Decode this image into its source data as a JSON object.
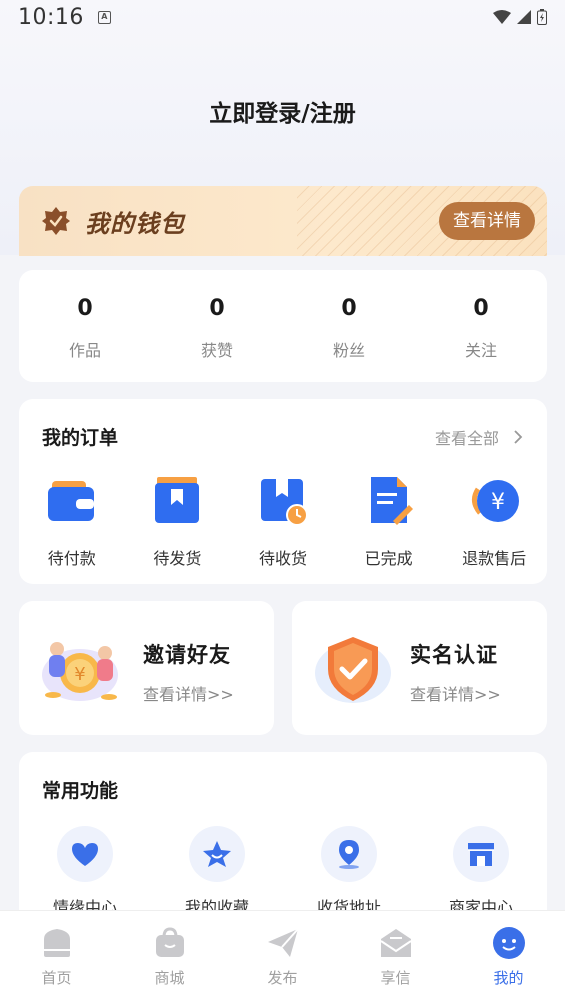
{
  "status_bar": {
    "time": "10:16",
    "notification_icon": "a-icon"
  },
  "header": {
    "login_text": "立即登录/注册"
  },
  "wallet": {
    "title": "我的钱包",
    "detail_button": "查看详情",
    "icon": "badge-icon"
  },
  "stats": [
    {
      "value": "0",
      "label": "作品"
    },
    {
      "value": "0",
      "label": "获赞"
    },
    {
      "value": "0",
      "label": "粉丝"
    },
    {
      "value": "0",
      "label": "关注"
    }
  ],
  "orders": {
    "title": "我的订单",
    "view_all": "查看全部",
    "items": [
      {
        "label": "待付款",
        "icon": "wallet-icon"
      },
      {
        "label": "待发货",
        "icon": "box-icon"
      },
      {
        "label": "待收货",
        "icon": "package-clock-icon"
      },
      {
        "label": "已完成",
        "icon": "document-check-icon"
      },
      {
        "label": "退款售后",
        "icon": "yen-refund-icon"
      }
    ]
  },
  "promos": {
    "invite": {
      "title": "邀请好友",
      "sub": "查看详情>>"
    },
    "verify": {
      "title": "实名认证",
      "sub": "查看详情>>"
    }
  },
  "functions": {
    "title": "常用功能",
    "items": [
      {
        "label": "情缘中心",
        "icon": "heart-icon"
      },
      {
        "label": "我的收藏",
        "icon": "star-icon"
      },
      {
        "label": "收货地址",
        "icon": "location-icon"
      },
      {
        "label": "商家中心",
        "icon": "store-icon"
      }
    ]
  },
  "tabbar": {
    "tabs": [
      {
        "label": "首页",
        "icon": "home-icon"
      },
      {
        "label": "商城",
        "icon": "shop-bag-icon"
      },
      {
        "label": "发布",
        "icon": "send-icon"
      },
      {
        "label": "享信",
        "icon": "mail-icon"
      },
      {
        "label": "我的",
        "icon": "profile-icon"
      }
    ],
    "active_index": 4
  },
  "colors": {
    "accent": "#3a6fe8",
    "wallet_button": "#b9763f",
    "wallet_text": "#6b3f1f"
  }
}
